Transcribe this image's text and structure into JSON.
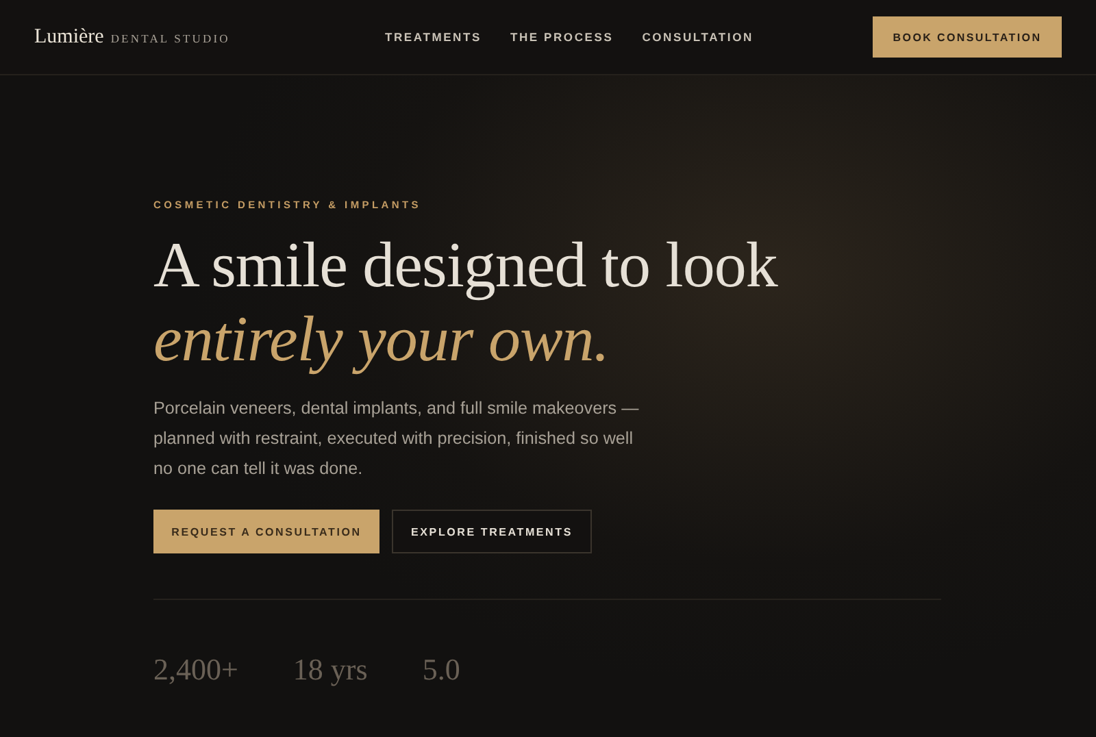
{
  "header": {
    "logo": "Lumière",
    "logo_sub": "DENTAL STUDIO",
    "nav": [
      "TREATMENTS",
      "THE PROCESS",
      "CONSULTATION"
    ],
    "cta": "BOOK CONSULTATION"
  },
  "hero": {
    "eyebrow": "COSMETIC DENTISTRY & IMPLANTS",
    "title": "A smile designed to look",
    "title_accent": "entirely your own.",
    "body": "Porcelain veneers, dental implants, and full smile makeovers — planned with restraint, executed with precision, finished so well no one can tell it was done.",
    "buttons": [
      {
        "label": "REQUEST A CONSULTATION",
        "kind": "primary"
      },
      {
        "label": "EXPLORE TREATMENTS",
        "kind": "secondary"
      }
    ]
  },
  "stats": [
    "2,400+",
    "18 yrs",
    "5.0"
  ]
}
